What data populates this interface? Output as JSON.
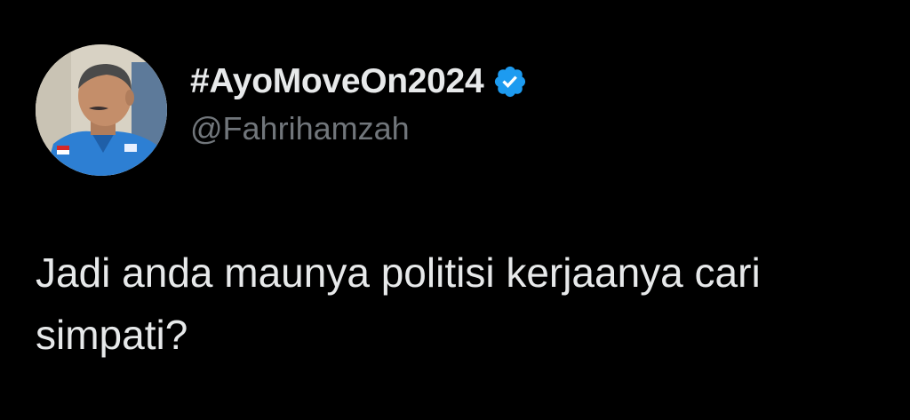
{
  "user": {
    "display_name": "#AyoMoveOn2024",
    "handle": "@Fahrihamzah",
    "verified": true,
    "verified_color": "#1d9bf0",
    "avatar_icon": "profile-photo"
  },
  "tweet": {
    "text": "Jadi anda maunya politisi kerjaanya cari simpati?"
  },
  "colors": {
    "background": "#000000",
    "text": "#e7e9ea",
    "secondary_text": "#71767b"
  }
}
